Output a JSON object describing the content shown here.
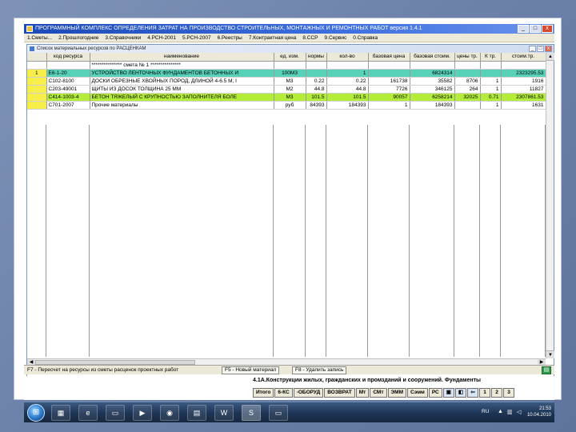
{
  "window": {
    "title": "ПРОГРАММНЫЙ КОМПЛЕКС ОПРЕДЕЛЕНИЯ ЗАТРАТ НА ПРОИЗВОДСТВО СТРОИТЕЛЬНЫХ, МОНТАЖНЫХ И РЕМОНТНЫХ РАБОТ версия 1.4.1",
    "minimize": "_",
    "maximize": "□",
    "close": "x"
  },
  "menu": [
    "1.Сметы...",
    "2.Прошлогодние",
    "3.Справочники",
    "4.РСН-2001",
    "5.РСН-2007",
    "6.Реестры",
    "7.Контрактная цена",
    "8.ССР",
    "9.Сервис",
    "0.Справка"
  ],
  "child": {
    "title": "Список материальных ресурсов по РАСЦЕНКАМ"
  },
  "table": {
    "headers": [
      "",
      "код ресурса",
      "наименование",
      "ед. изм.",
      "нормы",
      "кол-во",
      "базовая цена",
      "базовая стоим.",
      "цены тр.",
      "К тр.",
      "стоим.тр."
    ],
    "section_label": "*************** смета № 1 ***************",
    "rows": [
      {
        "style": "teal",
        "marker": "1",
        "code": "Е6-1-20",
        "name": "УСТРОЙСТВО ЛЕНТОЧНЫХ ФУНДАМЕНТОВ БЕТОННЫХ И",
        "unit": "100М3",
        "norm": "",
        "qty": "1",
        "base_price": "",
        "base_cost": "6824314",
        "tr_price": "",
        "k_tr": "",
        "tr_cost": "2323295.53"
      },
      {
        "style": "white",
        "marker": "",
        "code": "С102-8100",
        "name": "ДОСКИ ОБРЕЗНЫЕ ХВОЙНЫХ ПОРОД, ДЛИНОЙ 4-6.5 М, I",
        "unit": "М3",
        "norm": "0.22",
        "qty": "0.22",
        "base_price": "161738",
        "base_cost": "35582",
        "tr_price": "8706",
        "k_tr": "1",
        "tr_cost": "1916"
      },
      {
        "style": "white",
        "marker": "",
        "code": "С203-49001",
        "name": "ЩИТЫ ИЗ ДОСОК ТОЛЩИНА 25 ММ",
        "unit": "М2",
        "norm": "44.8",
        "qty": "44.8",
        "base_price": "7726",
        "base_cost": "346125",
        "tr_price": "264",
        "k_tr": "1",
        "tr_cost": "11827"
      },
      {
        "style": "green",
        "marker": "",
        "code": "С414-1003-4",
        "name": "БЕТОН ТЯЖЕЛЫЙ С КРУПНОСТЬЮ ЗАПОЛНИТЕЛЯ БОЛЕ",
        "unit": "М3",
        "norm": "101.5",
        "qty": "101.5",
        "base_price": "90057",
        "base_cost": "6258214",
        "tr_price": "32025",
        "k_tr": "0.71",
        "tr_cost": "2307861.53"
      },
      {
        "style": "white",
        "marker": "",
        "code": "С701-2007",
        "name": "Прочие материалы",
        "unit": "руб",
        "norm": "84393",
        "qty": "184393",
        "base_price": "1",
        "base_cost": "184393",
        "tr_price": "",
        "k_tr": "1",
        "tr_cost": "1631"
      }
    ]
  },
  "status": {
    "text": "F7 - Пересчет на ресурсы из сметы расценок проектных работ",
    "f5": "F5 - Новый материал",
    "f8": "F8 - Удалить запись"
  },
  "info": {
    "text": "4.1А.Конструкции жилых, гражданских и промзданий и сооружений. Фундаменты"
  },
  "tools": [
    "Итого",
    "6-КС",
    "-ОБОРУД",
    "ВОЗВРАТ",
    "Мт",
    "СМт",
    "ЭММ",
    "Сэмм",
    "РС",
    "1",
    "2",
    "3"
  ],
  "taskbar": {
    "lang": "RU",
    "time": "21:53",
    "date": "10.04.2010"
  }
}
